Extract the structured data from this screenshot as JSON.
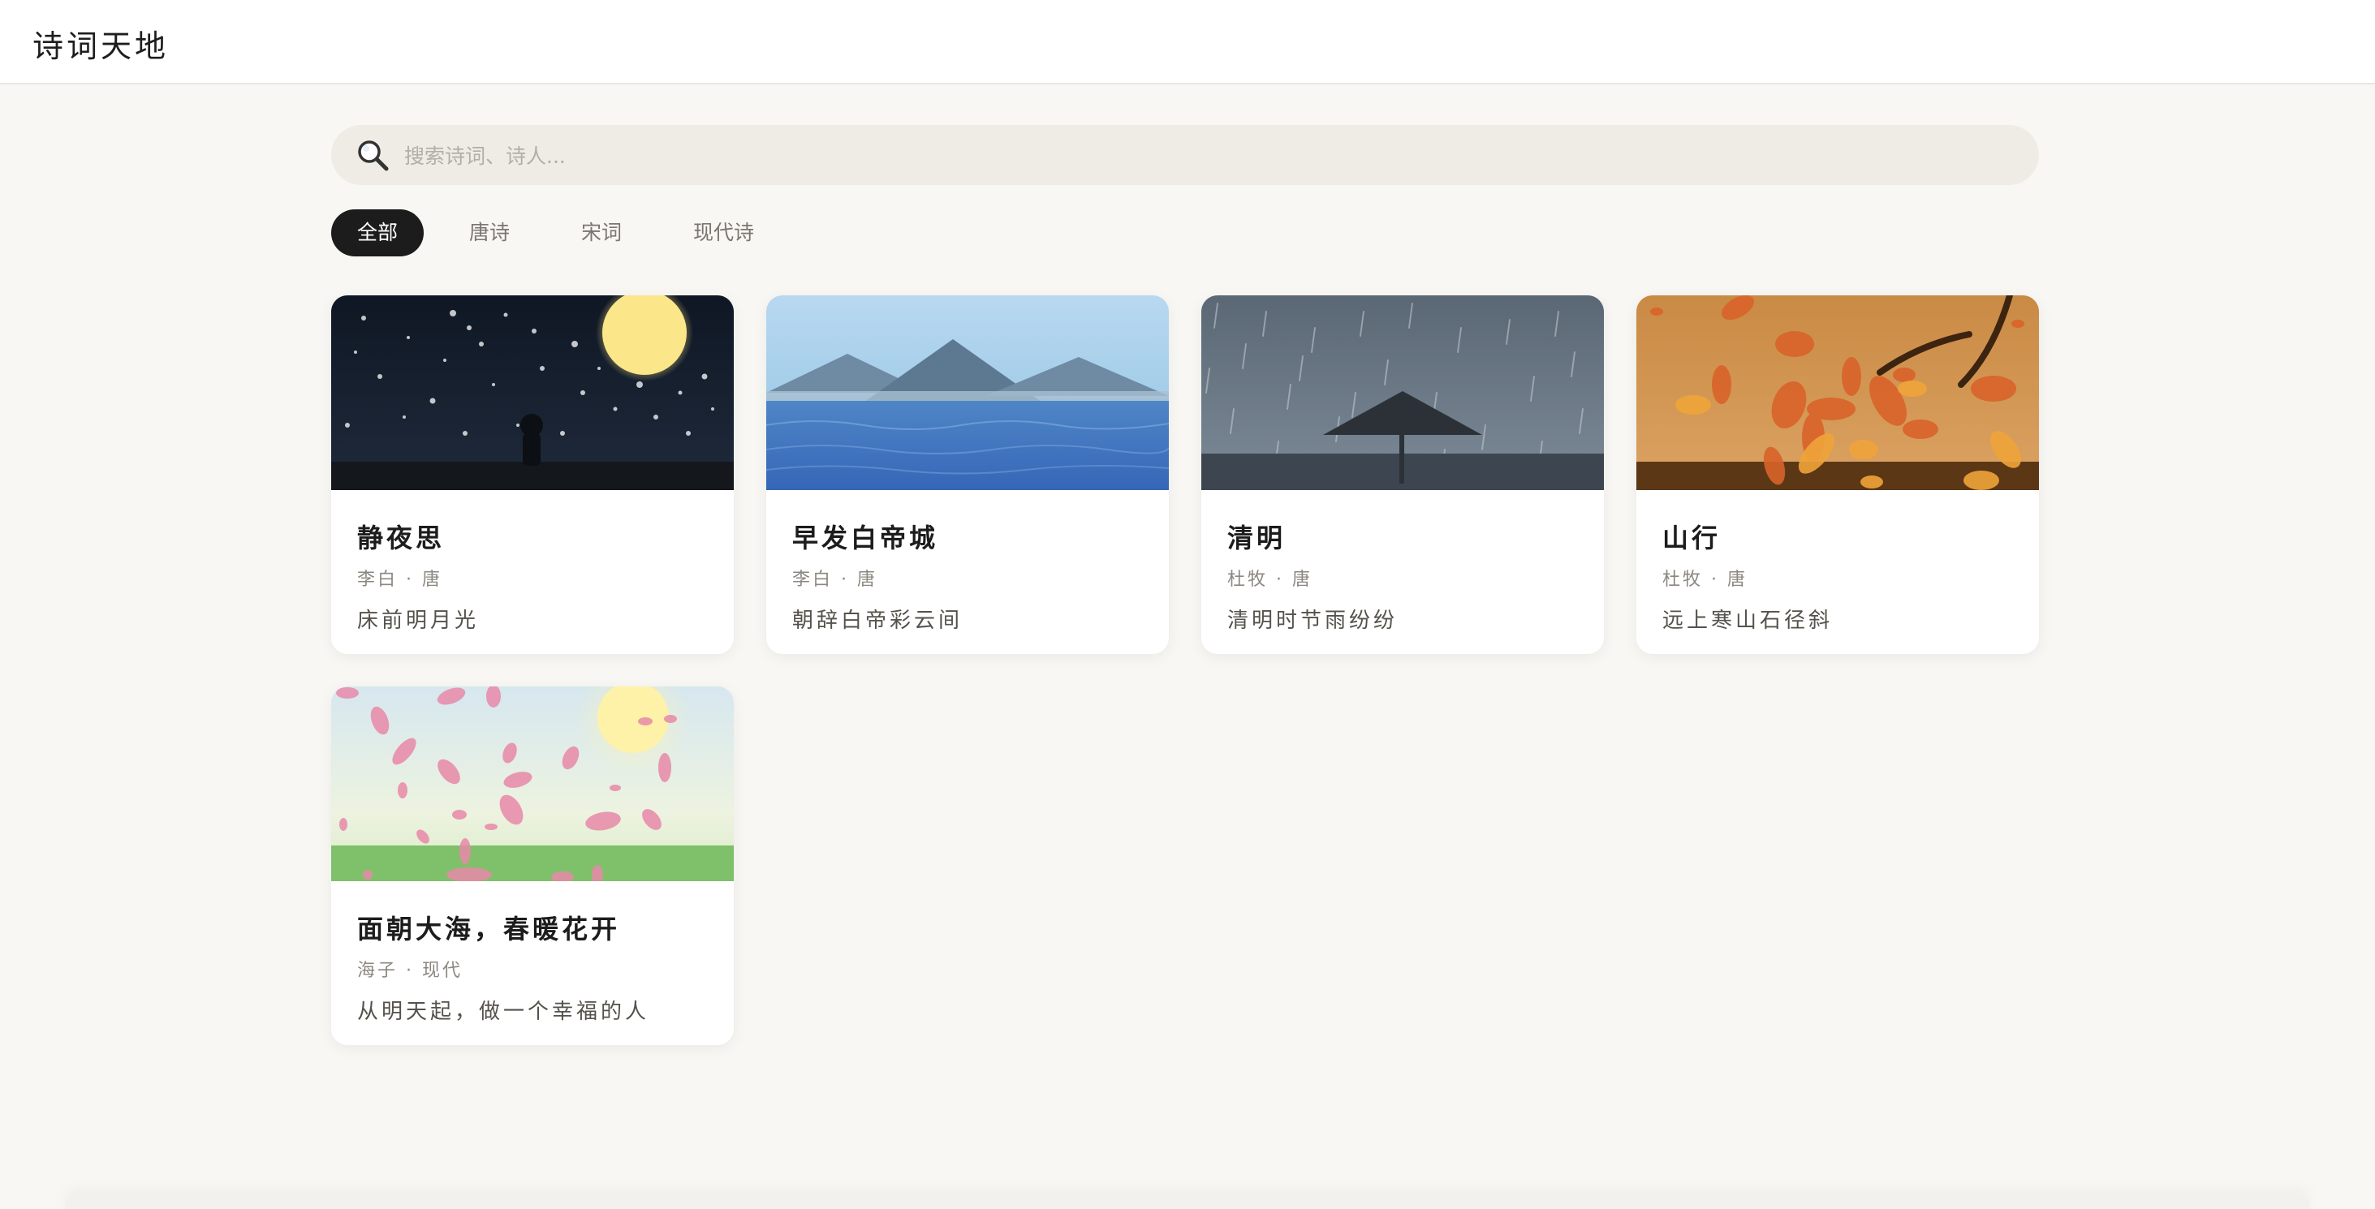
{
  "header": {
    "title": "诗词天地"
  },
  "search": {
    "placeholder": "搜索诗词、诗人..."
  },
  "tabs": [
    {
      "label": "全部",
      "active": true
    },
    {
      "label": "唐诗",
      "active": false
    },
    {
      "label": "宋词",
      "active": false
    },
    {
      "label": "现代诗",
      "active": false
    }
  ],
  "poems": [
    {
      "title": "静夜思",
      "meta": "李白 · 唐",
      "line": "床前明月光",
      "cover_icon": "moonlit-night-image"
    },
    {
      "title": "早发白帝城",
      "meta": "李白 · 唐",
      "line": "朝辞白帝彩云间",
      "cover_icon": "mountain-river-image"
    },
    {
      "title": "清明",
      "meta": "杜牧 · 唐",
      "line": "清明时节雨纷纷",
      "cover_icon": "rain-umbrella-image"
    },
    {
      "title": "山行",
      "meta": "杜牧 · 唐",
      "line": "远上寒山石径斜",
      "cover_icon": "autumn-leaves-image"
    },
    {
      "title": "面朝大海，春暖花开",
      "meta": "海子 · 现代",
      "line": "从明天起，做一个幸福的人",
      "cover_icon": "spring-petals-image"
    }
  ]
}
